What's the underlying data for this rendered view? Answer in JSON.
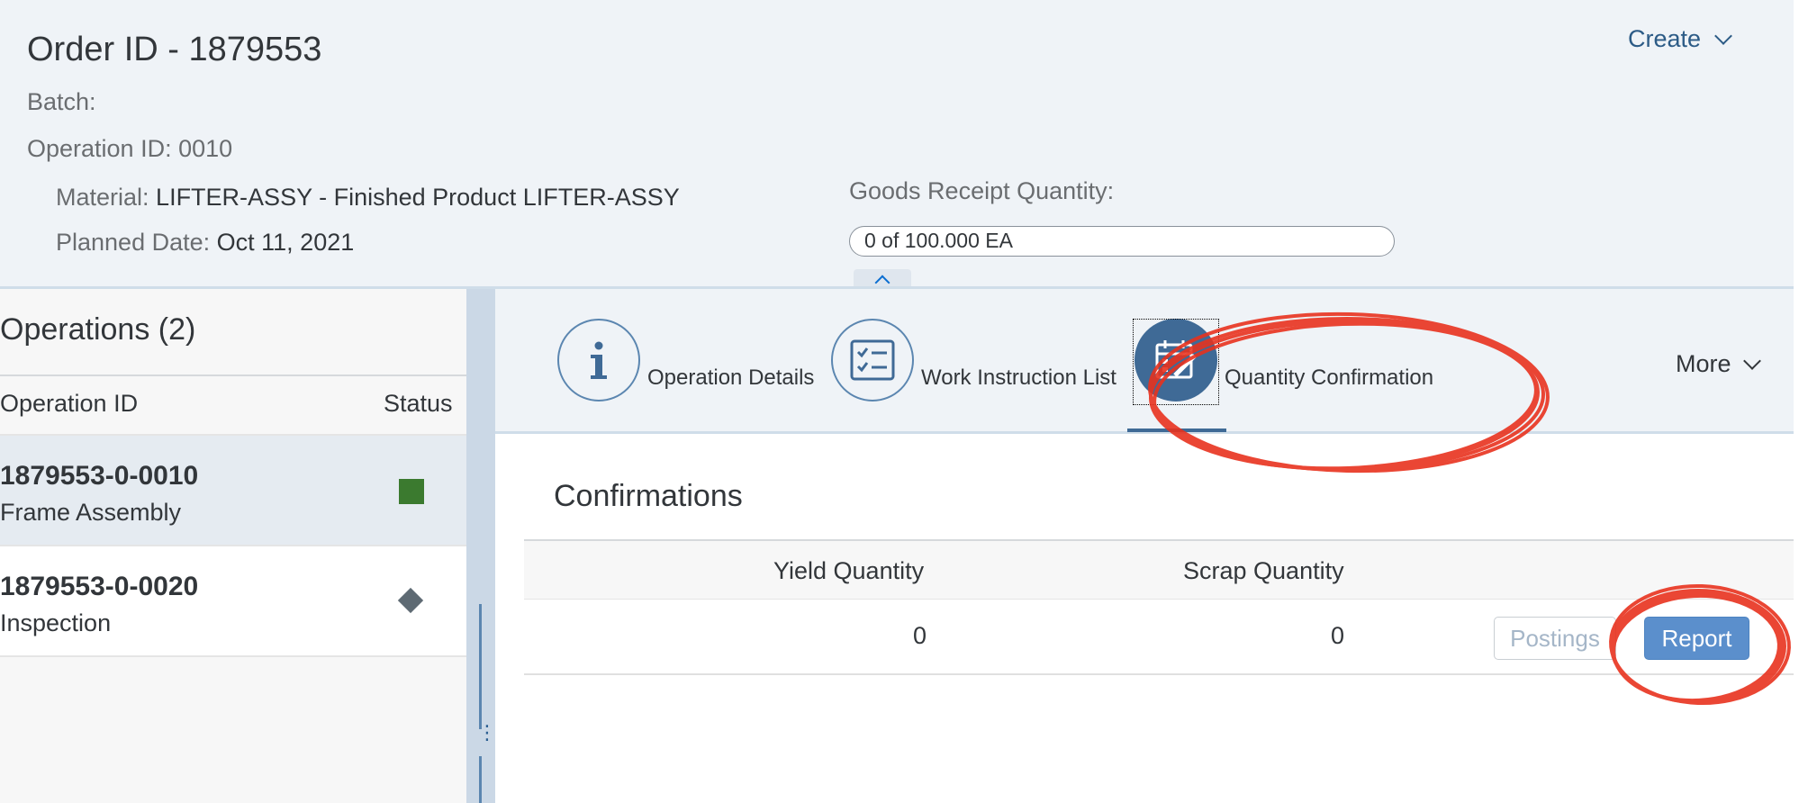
{
  "header": {
    "order_title": "Order ID - 1879553",
    "batch_label": "Batch:",
    "operation_label": "Operation ID: 0010",
    "material_label": "Material:",
    "material_value": "LIFTER-ASSY - Finished Product LIFTER-ASSY",
    "planned_date_label": "Planned Date:",
    "planned_date_value": "Oct 11, 2021",
    "create_label": "Create",
    "goods_receipt_label": "Goods Receipt Quantity:",
    "goods_receipt_value": "0 of 100.000 EA",
    "goods_receipt_progress": 0
  },
  "operations": {
    "title": "Operations (2)",
    "col_operation_id": "Operation ID",
    "col_status": "Status",
    "rows": [
      {
        "id": "1879553-0-0010",
        "desc": "Frame Assembly",
        "status_icon": "green-square-status-icon",
        "selected": true
      },
      {
        "id": "1879553-0-0020",
        "desc": "Inspection",
        "status_icon": "gray-diamond-status-icon",
        "selected": false
      }
    ]
  },
  "tabs": {
    "items": [
      {
        "label": "Operation Details",
        "icon": "info-icon"
      },
      {
        "label": "Work Instruction List",
        "icon": "checklist-icon"
      },
      {
        "label": "Quantity Confirmation",
        "icon": "calendar-edit-icon",
        "active": true
      }
    ],
    "more_label": "More"
  },
  "confirmations": {
    "title": "Confirmations",
    "col_yield": "Yield Quantity",
    "col_scrap": "Scrap Quantity",
    "yield_value": "0",
    "scrap_value": "0",
    "postings_label": "Postings",
    "report_label": "Report"
  },
  "colors": {
    "accent": "#3f6a96",
    "status_green": "#3b7a2f",
    "annotation_red": "#e8321e",
    "report_button": "#5b8fcc"
  }
}
